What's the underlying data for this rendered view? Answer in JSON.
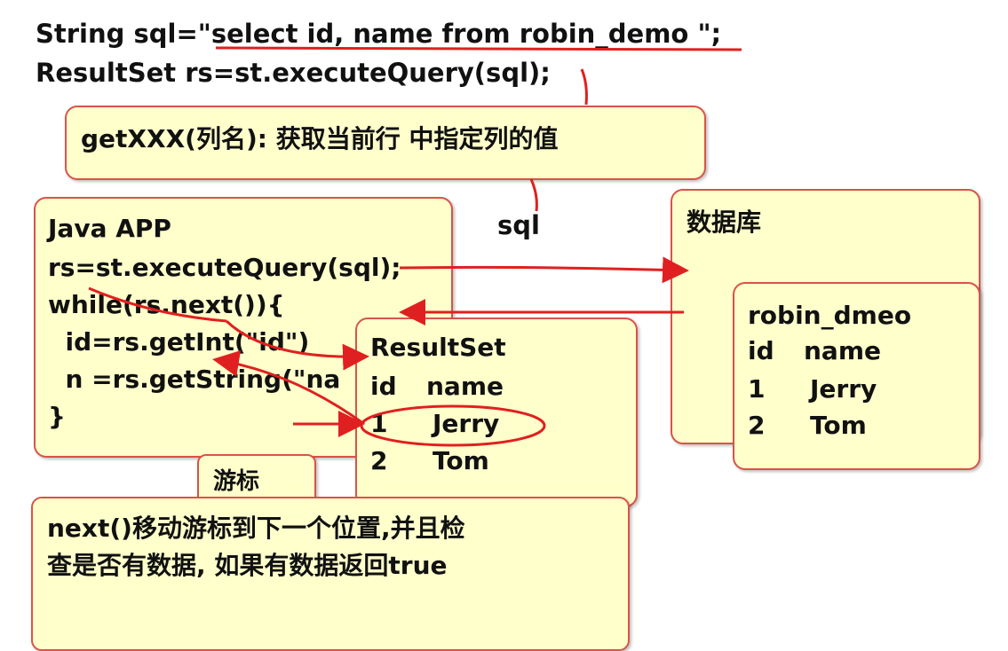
{
  "top_code": {
    "line1": "String sql=\"select id, name from robin_demo \";",
    "line2": "ResultSet rs=st.executeQuery(sql);"
  },
  "getxxx_box": {
    "text": "getXXX(列名): 获取当前行 中指定列的值"
  },
  "sql_label": "sql",
  "java_app_box": {
    "lines": [
      "Java APP",
      "rs=st.executeQuery(sql);",
      "while(rs.next()){",
      "  id=rs.getInt(\"id\")",
      "  n =rs.getString(\"na",
      "}"
    ]
  },
  "database_box": {
    "title": "数据库"
  },
  "robin_table_box": {
    "title": "robin_dmeo",
    "header": [
      "id",
      "name"
    ],
    "rows": [
      [
        "1",
        "Jerry"
      ],
      [
        "2",
        "Tom"
      ]
    ]
  },
  "resultset_box": {
    "title": "ResultSet",
    "header": [
      "id",
      "name"
    ],
    "rows": [
      [
        "1",
        "Jerry"
      ],
      [
        "2",
        "Tom"
      ]
    ]
  },
  "cursor_box": {
    "label": "游标"
  },
  "next_box": {
    "line1": "next()移动游标到下一个位置,并且检",
    "line2": "查是否有数据, 如果有数据返回true"
  },
  "colors": {
    "box_fill": "#ffffcc",
    "box_border": "#d9534a",
    "arrow": "#e02020"
  }
}
